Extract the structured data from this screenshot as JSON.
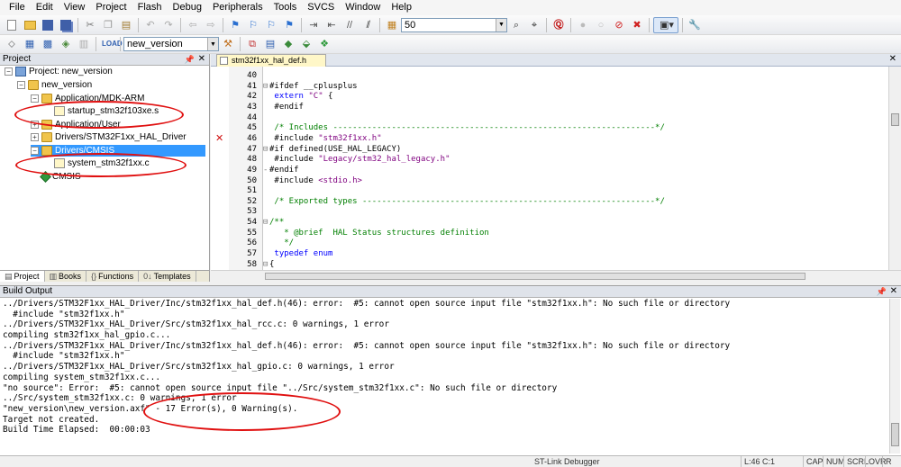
{
  "menu": [
    "File",
    "Edit",
    "View",
    "Project",
    "Flash",
    "Debug",
    "Peripherals",
    "Tools",
    "SVCS",
    "Window",
    "Help"
  ],
  "toolbar": {
    "find_value": "50",
    "target_value": "new_version"
  },
  "project_panel": {
    "title": "Project",
    "tree": [
      {
        "label": "Project: new_version",
        "level": 0,
        "icon": "project-icon",
        "expander": "−"
      },
      {
        "label": "new_version",
        "level": 1,
        "icon": "folder-icon",
        "expander": "−"
      },
      {
        "label": "Application/MDK-ARM",
        "level": 2,
        "icon": "folder-icon",
        "expander": "−"
      },
      {
        "label": "startup_stm32f103xe.s",
        "level": 3,
        "icon": "file-icon",
        "expander": ""
      },
      {
        "label": "Application/User",
        "level": 2,
        "icon": "folder-icon",
        "expander": "+"
      },
      {
        "label": "Drivers/STM32F1xx_HAL_Driver",
        "level": 2,
        "icon": "folder-icon",
        "expander": "+"
      },
      {
        "label": "Drivers/CMSIS",
        "level": 2,
        "icon": "folder-icon",
        "expander": "−",
        "selected": true
      },
      {
        "label": "system_stm32f1xx.c",
        "level": 3,
        "icon": "file-icon",
        "expander": ""
      },
      {
        "label": "CMSIS",
        "level": 2,
        "icon": "diamond-icon",
        "expander": ""
      }
    ],
    "tabs": [
      {
        "label": "Project",
        "active": true
      },
      {
        "label": "Books",
        "active": false
      },
      {
        "label": "Functions",
        "active": false
      },
      {
        "label": "Templates",
        "active": false
      }
    ]
  },
  "editor": {
    "tab_title": "stm32f1xx_hal_def.h",
    "lines": [
      {
        "n": "40",
        "text": ""
      },
      {
        "n": "41",
        "text": "#ifdef __cplusplus",
        "fold": "⊟"
      },
      {
        "n": "42",
        "text": " extern \"C\" {"
      },
      {
        "n": "43",
        "text": " #endif"
      },
      {
        "n": "44",
        "text": ""
      },
      {
        "n": "45",
        "text": " /* Includes ------------------------------------------------------------------*/"
      },
      {
        "n": "46",
        "text": " #include \"stm32f1xx.h\"",
        "error": true
      },
      {
        "n": "47",
        "text": "#if defined(USE_HAL_LEGACY)",
        "fold": "⊟"
      },
      {
        "n": "48",
        "text": " #include \"Legacy/stm32_hal_legacy.h\""
      },
      {
        "n": "49",
        "text": "#endif",
        "fold": "-"
      },
      {
        "n": "50",
        "text": " #include <stdio.h>"
      },
      {
        "n": "51",
        "text": ""
      },
      {
        "n": "52",
        "text": " /* Exported types ------------------------------------------------------------*/"
      },
      {
        "n": "53",
        "text": ""
      },
      {
        "n": "54",
        "text": "/**",
        "fold": "⊟"
      },
      {
        "n": "55",
        "text": "   * @brief  HAL Status structures definition"
      },
      {
        "n": "56",
        "text": "   */"
      },
      {
        "n": "57",
        "text": " typedef enum"
      },
      {
        "n": "58",
        "text": "{",
        "fold": "⊟"
      }
    ]
  },
  "build_output": {
    "title": "Build Output",
    "lines": [
      "../Drivers/STM32F1xx_HAL_Driver/Inc/stm32f1xx_hal_def.h(46): error:  #5: cannot open source input file \"stm32f1xx.h\": No such file or directory",
      "  #include \"stm32f1xx.h\"",
      "../Drivers/STM32F1xx_HAL_Driver/Src/stm32f1xx_hal_rcc.c: 0 warnings, 1 error",
      "compiling stm32f1xx_hal_gpio.c...",
      "../Drivers/STM32F1xx_HAL_Driver/Inc/stm32f1xx_hal_def.h(46): error:  #5: cannot open source input file \"stm32f1xx.h\": No such file or directory",
      "  #include \"stm32f1xx.h\"",
      "../Drivers/STM32F1xx_HAL_Driver/Src/stm32f1xx_hal_gpio.c: 0 warnings, 1 error",
      "compiling system_stm32f1xx.c...",
      "\"no source\": Error:  #5: cannot open source input file \"../Src/system_stm32f1xx.c\": No such file or directory",
      "../Src/system_stm32f1xx.c: 0 warnings, 1 error",
      "\"new_version\\new_version.axf\" - 17 Error(s), 0 Warning(s).",
      "Target not created.",
      "Build Time Elapsed:  00:00:03"
    ]
  },
  "status": {
    "debugger": "ST-Link Debugger",
    "position": "L:46 C:1",
    "caps": "CAP",
    "num": "NUM",
    "scrl": "SCRL",
    "ovr": "OVR",
    "rw": "R /W"
  },
  "colors": {
    "annotation": "#e01010",
    "selection": "#3399ff",
    "keyword": "#0000ff",
    "comment": "#007f00",
    "string": "#7f007f"
  }
}
